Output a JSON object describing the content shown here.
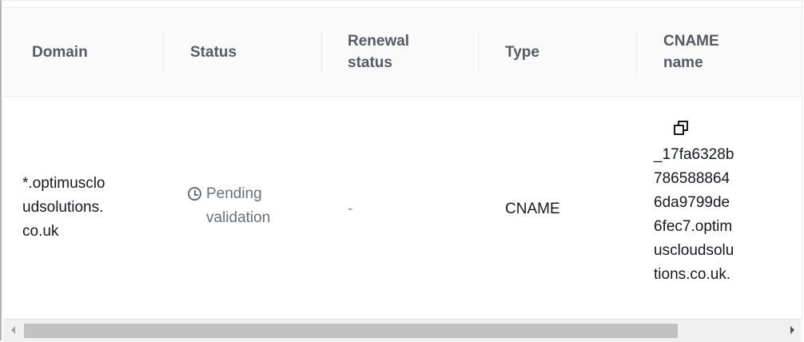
{
  "table": {
    "columns": [
      {
        "label": "Domain"
      },
      {
        "label": "Status"
      },
      {
        "label": "Renewal\nstatus"
      },
      {
        "label": "Type"
      },
      {
        "label": "CNAME\nname"
      }
    ],
    "rows": [
      {
        "domain": "*.optimusclo\nudsolutions.\nco.uk",
        "status": "Pending\nvalidation",
        "renewal_status": "-",
        "type": "CNAME",
        "cname_name": "_17fa6328b\n786588864\n6da9799de\n6fec7.optim\nuscloudsolu\ntions.co.uk."
      }
    ]
  },
  "icons": {
    "status": "clock-icon",
    "copy": "copy-icon"
  },
  "colors": {
    "header_text": "#545b64",
    "pending_status": "#687078",
    "body_text": "#16191f"
  }
}
